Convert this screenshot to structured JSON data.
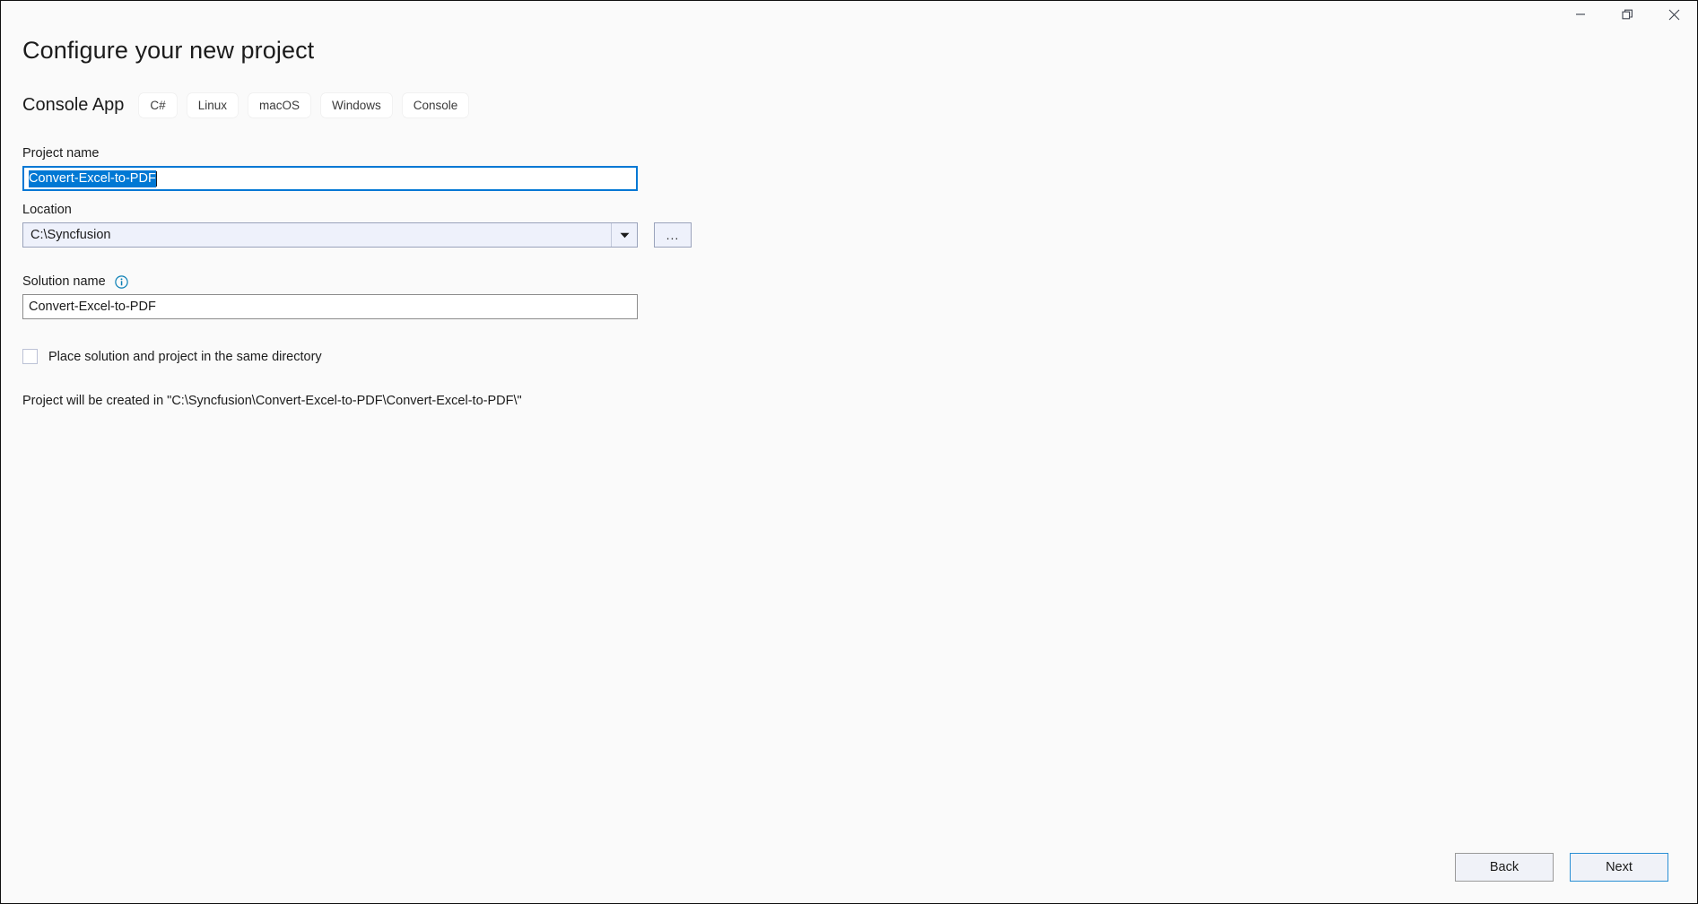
{
  "titlebar": {
    "buttons": [
      {
        "name": "minimize",
        "icon": "minimize-icon",
        "tooltip": "Minimize"
      },
      {
        "name": "restore",
        "icon": "restore-icon",
        "tooltip": "Restore Down"
      },
      {
        "name": "close",
        "icon": "close-icon",
        "tooltip": "Close"
      }
    ]
  },
  "page": {
    "title": "Configure your new project",
    "template_name": "Console App",
    "tags": [
      "C#",
      "Linux",
      "macOS",
      "Windows",
      "Console"
    ]
  },
  "fields": {
    "project_name": {
      "label": "Project name",
      "value": "Convert-Excel-to-PDF",
      "placeholder": "",
      "selected": true,
      "focused": true
    },
    "location": {
      "label": "Location",
      "value": "C:\\Syncfusion",
      "placeholder": "",
      "browse_label": "...",
      "dropdown_icon": "chevron-down-icon"
    },
    "solution_name": {
      "label": "Solution name",
      "info_icon": "info-icon",
      "value": "Convert-Excel-to-PDF",
      "placeholder": ""
    },
    "same_directory": {
      "label": "Place solution and project in the same directory",
      "checked": false
    }
  },
  "note": "Project will be created in \"C:\\Syncfusion\\Convert-Excel-to-PDF\\Convert-Excel-to-PDF\\\"",
  "footer": {
    "back_label": "Back",
    "next_label": "Next"
  },
  "colors": {
    "accent": "#0078d4",
    "selection": "#0078d4",
    "info": "#0a7fb5",
    "window_bg": "#fafafa",
    "combo_bg": "#eef1fb",
    "primary_border": "#2a8fd4"
  }
}
